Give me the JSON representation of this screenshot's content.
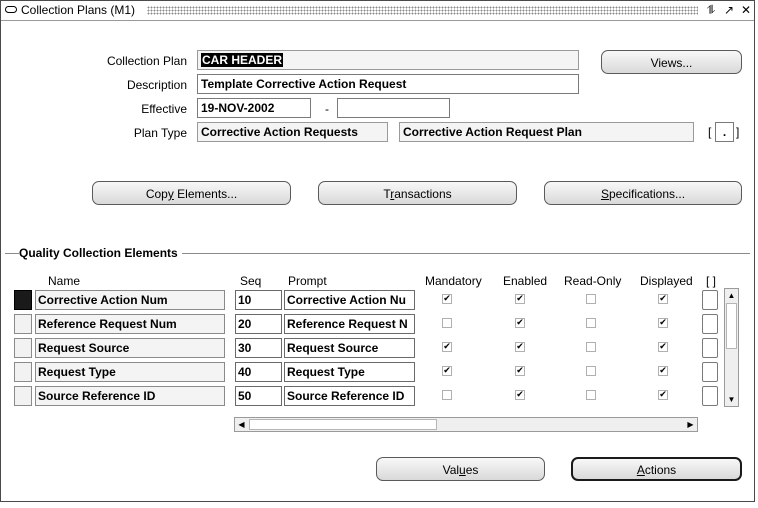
{
  "window": {
    "title": "Collection Plans (M1)",
    "buttons": {
      "restore": "⥮",
      "maximize": "↗",
      "close": "✕"
    }
  },
  "header": {
    "collection_plan_label": "Collection Plan",
    "collection_plan_value": "CAR HEADER",
    "description_label": "Description",
    "description_value": "Template Corrective Action Request",
    "effective_label": "Effective",
    "effective_from": "19-NOV-2002",
    "effective_sep": "-",
    "effective_to": "",
    "plan_type_label": "Plan Type",
    "plan_type_value": "Corrective Action Requests",
    "plan_type_desc": "Corrective Action Request Plan",
    "flex_open": "[",
    "flex_close": "]",
    "views_button": "Views..."
  },
  "actions_top": {
    "copy_pre": "Cop",
    "copy_ul": "y",
    "copy_post": " Elements...",
    "trans_pre": "T",
    "trans_ul": "r",
    "trans_post": "ansactions",
    "spec_ul": "S",
    "spec_post": "pecifications..."
  },
  "section": {
    "title": "Quality Collection Elements",
    "columns": {
      "name": "Name",
      "seq": "Seq",
      "prompt": "Prompt",
      "mandatory": "Mandatory",
      "enabled": "Enabled",
      "read_only": "Read-Only",
      "displayed": "Displayed",
      "flex": "[ ]"
    },
    "rows": [
      {
        "name": "Corrective Action Num",
        "seq": "10",
        "prompt": "Corrective Action Nu",
        "mandatory": true,
        "enabled": true,
        "read_only": false,
        "displayed": true
      },
      {
        "name": "Reference Request Num",
        "seq": "20",
        "prompt": "Reference Request N",
        "mandatory": false,
        "enabled": true,
        "read_only": false,
        "displayed": true
      },
      {
        "name": "Request Source",
        "seq": "30",
        "prompt": "Request Source",
        "mandatory": true,
        "enabled": true,
        "read_only": false,
        "displayed": true
      },
      {
        "name": "Request Type",
        "seq": "40",
        "prompt": "Request Type",
        "mandatory": true,
        "enabled": true,
        "read_only": false,
        "displayed": true
      },
      {
        "name": "Source Reference ID",
        "seq": "50",
        "prompt": "Source Reference ID",
        "mandatory": false,
        "enabled": true,
        "read_only": false,
        "displayed": true
      }
    ]
  },
  "actions_bottom": {
    "values_pre": "Val",
    "values_ul": "u",
    "values_post": "es",
    "actions_ul": "A",
    "actions_post": "ctions"
  },
  "scroll": {
    "up": "▲",
    "down": "▼",
    "left": "◀",
    "right": "▶"
  }
}
